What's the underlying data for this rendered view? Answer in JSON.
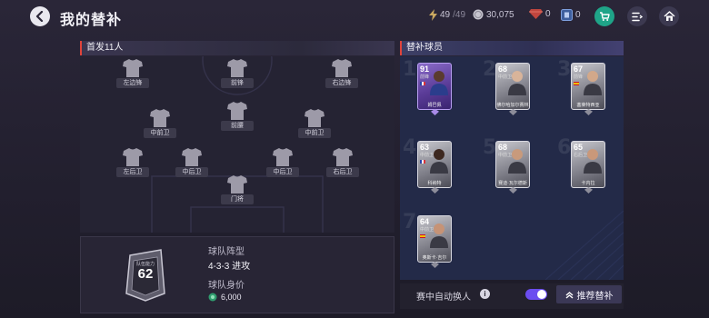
{
  "header": {
    "title": "我的替补",
    "stamina": "49",
    "stamina_max": "/49",
    "coins": "30,075",
    "gems": "0",
    "tickets": "0"
  },
  "lineup": {
    "heading": "首发11人",
    "positions": {
      "lw": "左边锋",
      "st": "前锋",
      "rw": "右边锋",
      "lcm": "中前卫",
      "cdm": "前腰",
      "rcm": "中前卫",
      "lb": "左后卫",
      "lcb": "中后卫",
      "rcb": "中后卫",
      "rb": "右后卫",
      "gk": "门将"
    }
  },
  "team": {
    "ovr_label": "队伍能力",
    "ovr": "62",
    "formation_label": "球队阵型",
    "formation": "4-3-3 进攻",
    "value_label": "球队身价",
    "value": "6,000"
  },
  "subs": {
    "heading": "替补球员",
    "slot_numbers": [
      "1",
      "2",
      "3",
      "4",
      "5",
      "6",
      "7"
    ],
    "players": [
      {
        "rating": "91",
        "pos": "前锋",
        "name": "姆巴佩"
      },
      {
        "rating": "68",
        "pos": "中前卫",
        "name": "佛尔哈加尔赛林"
      },
      {
        "rating": "67",
        "pos": "前锋",
        "name": "塞莱特西亚"
      },
      {
        "rating": "63",
        "pos": "中前卫",
        "name": "科纳特"
      },
      {
        "rating": "68",
        "pos": "中前卫",
        "name": "赛迪·瓦尔德斯"
      },
      {
        "rating": "65",
        "pos": "右后卫",
        "name": "卡内拉"
      },
      {
        "rating": "64",
        "pos": "中前卫",
        "name": "奥斯卡·吉尔"
      }
    ]
  },
  "footer": {
    "auto_sub_label": "赛中自动换人",
    "info": "i",
    "recommend_label": "推荐替补"
  },
  "colors": {
    "accent_red": "#e0443b",
    "toggle_purple": "#6b4df0",
    "sub_panel": "#232a48"
  }
}
